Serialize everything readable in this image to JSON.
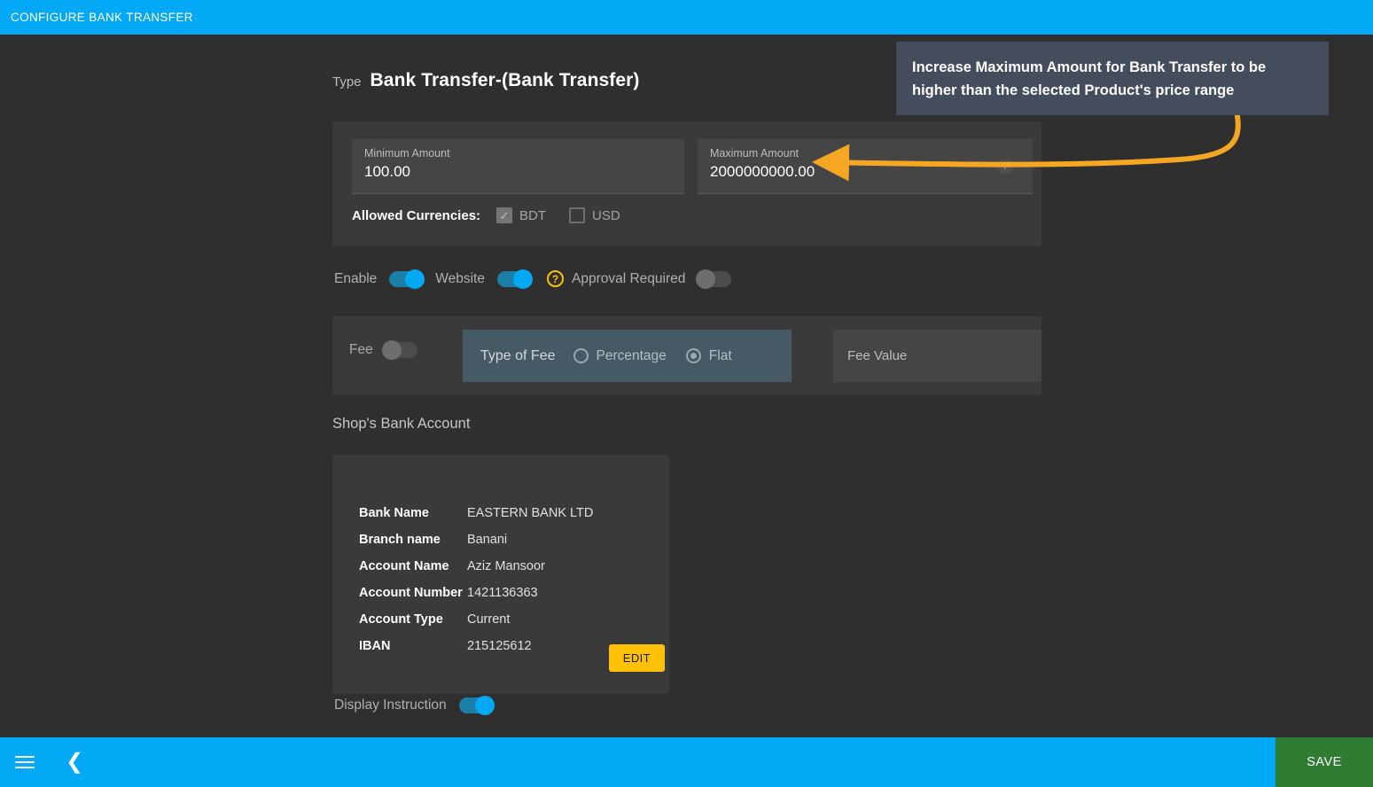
{
  "header": {
    "title": "CONFIGURE BANK TRANSFER",
    "accent_color": "#03a9f4"
  },
  "type_row": {
    "label": "Type",
    "value": "Bank Transfer-(Bank Transfer)"
  },
  "amount_card": {
    "minimum": {
      "label": "Minimum Amount",
      "value": "100.00"
    },
    "maximum": {
      "label": "Maximum Amount",
      "value": "2000000000.00"
    },
    "info_icon_glyph": "i",
    "currencies": {
      "title": "Allowed Currencies:",
      "options": [
        {
          "label": "BDT",
          "checked": true,
          "check_glyph": "✓"
        },
        {
          "label": "USD",
          "checked": false,
          "check_glyph": ""
        }
      ]
    }
  },
  "toggles": {
    "enable": {
      "label": "Enable",
      "state": "on"
    },
    "website": {
      "label": "Website",
      "state": "on"
    },
    "approval": {
      "label": "Approval Required",
      "state": "off",
      "help_glyph": "?"
    }
  },
  "fee_card": {
    "fee_label": "Fee",
    "fee_state": "off",
    "type_of_fee_label": "Type of Fee",
    "options": [
      {
        "label": "Percentage",
        "selected": false
      },
      {
        "label": "Flat",
        "selected": true
      }
    ],
    "fee_value_placeholder": "Fee Value",
    "fee_value": ""
  },
  "bank_account": {
    "section_title": "Shop's Bank Account",
    "rows": [
      {
        "key": "Bank Name",
        "value": "EASTERN BANK LTD"
      },
      {
        "key": "Branch name",
        "value": "Banani"
      },
      {
        "key": "Account Name",
        "value": "Aziz Mansoor"
      },
      {
        "key": "Account Number",
        "value": "1421136363"
      },
      {
        "key": "Account Type",
        "value": "Current"
      },
      {
        "key": "IBAN",
        "value": "215125612"
      }
    ],
    "edit_label": "EDIT",
    "edit_color": "#ffc107"
  },
  "display_instruction": {
    "label": "Display Instruction",
    "state": "on"
  },
  "bottombar": {
    "menu_icon": "hamburger-icon",
    "back_icon": "chevron-left-icon",
    "save_label": "SAVE",
    "save_color": "#2e7d32"
  },
  "annotation": {
    "text": "Increase Maximum Amount for Bank Transfer to be higher than the selected Product's price range",
    "arrow_color": "#f5a623",
    "box_color": "#434d5c"
  }
}
